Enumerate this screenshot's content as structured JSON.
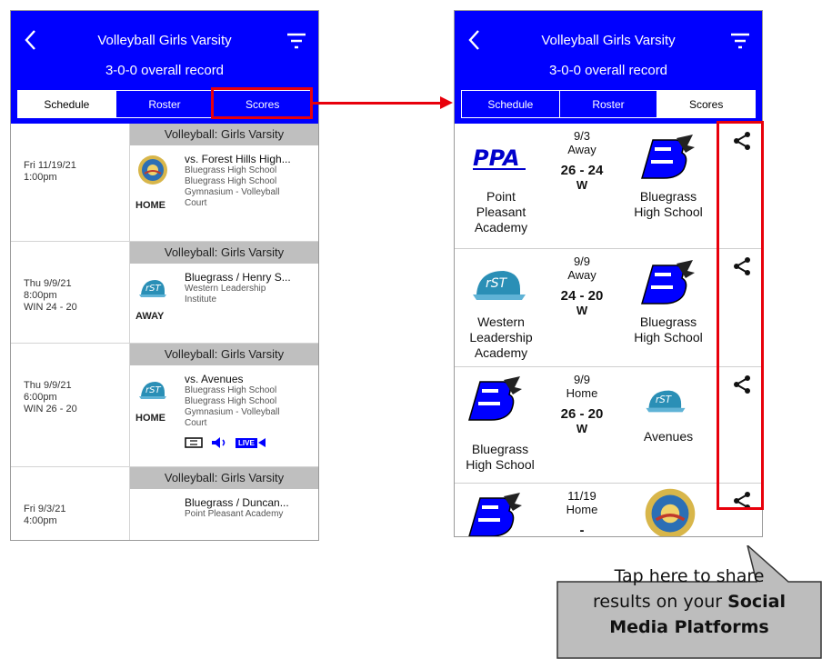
{
  "header": {
    "title": "Volleyball Girls Varsity",
    "record": "3-0-0 overall record"
  },
  "tabs": [
    "Schedule",
    "Roster",
    "Scores"
  ],
  "left_active_tab": "Schedule",
  "right_active_tab": "Scores",
  "schedule": [
    {
      "band": "Volleyball: Girls Varsity",
      "date": "Fri 11/19/21",
      "time": "1:00pm",
      "result": "",
      "where": "HOME",
      "opponent": "vs. Forest Hills High...",
      "lines": [
        "Bluegrass High School",
        "Bluegrass High School",
        "Gymnasium - Volleyball",
        "Court"
      ]
    },
    {
      "band": "Volleyball: Girls Varsity",
      "date": "Thu 9/9/21",
      "time": "8:00pm",
      "result": "WIN 24 - 20",
      "where": "AWAY",
      "opponent": "Bluegrass / Henry S...",
      "lines": [
        "Western Leadership",
        "Institute"
      ]
    },
    {
      "band": "Volleyball: Girls Varsity",
      "date": "Thu 9/9/21",
      "time": "6:00pm",
      "result": "WIN 26 - 20",
      "where": "HOME",
      "opponent": "vs. Avenues",
      "lines": [
        "Bluegrass High School",
        "Bluegrass High School",
        "Gymnasium - Volleyball",
        "Court"
      ],
      "live_label": "LIVE"
    },
    {
      "band": "Volleyball: Girls Varsity",
      "date": "Fri 9/3/21",
      "time": "4:00pm",
      "result": "",
      "where": "",
      "opponent": "Bluegrass / Duncan...",
      "lines": [
        "Point Pleasant Academy"
      ]
    }
  ],
  "scores": [
    {
      "date": "9/3",
      "venue": "Away",
      "score": "26 - 24",
      "outcome": "W",
      "home_team": "Point\nPleasant\nAcademy",
      "away_team": "Bluegrass\nHigh School",
      "home_logo": "ppa-logo",
      "away_logo": "bluegrass-b-logo"
    },
    {
      "date": "9/9",
      "venue": "Away",
      "score": "24 - 20",
      "outcome": "W",
      "home_team": "Western\nLeadership\nAcademy",
      "away_team": "Bluegrass\nHigh School",
      "home_logo": "rst-cap-logo",
      "away_logo": "bluegrass-b-logo"
    },
    {
      "date": "9/9",
      "venue": "Home",
      "score": "26 - 20",
      "outcome": "W",
      "home_team": "Bluegrass\nHigh School",
      "away_team": "Avenues",
      "home_logo": "bluegrass-b-logo",
      "away_logo": "rst-cap-logo"
    },
    {
      "date": "11/19",
      "venue": "Home",
      "score": "-",
      "outcome": "",
      "home_team": "",
      "away_team": "",
      "home_logo": "bluegrass-b-logo",
      "away_logo": "forest-hills-seal-logo"
    }
  ],
  "ppa_logo_text": "PPA",
  "callout": {
    "line1": "Tap here to share",
    "line2": "results on your",
    "bold1": "Social",
    "bold2": "Media Platforms"
  },
  "colors": {
    "brand": "#0000ff",
    "annotation": "#e8000b",
    "band": "#bfbfbf",
    "callout": "#bdbdbd"
  }
}
